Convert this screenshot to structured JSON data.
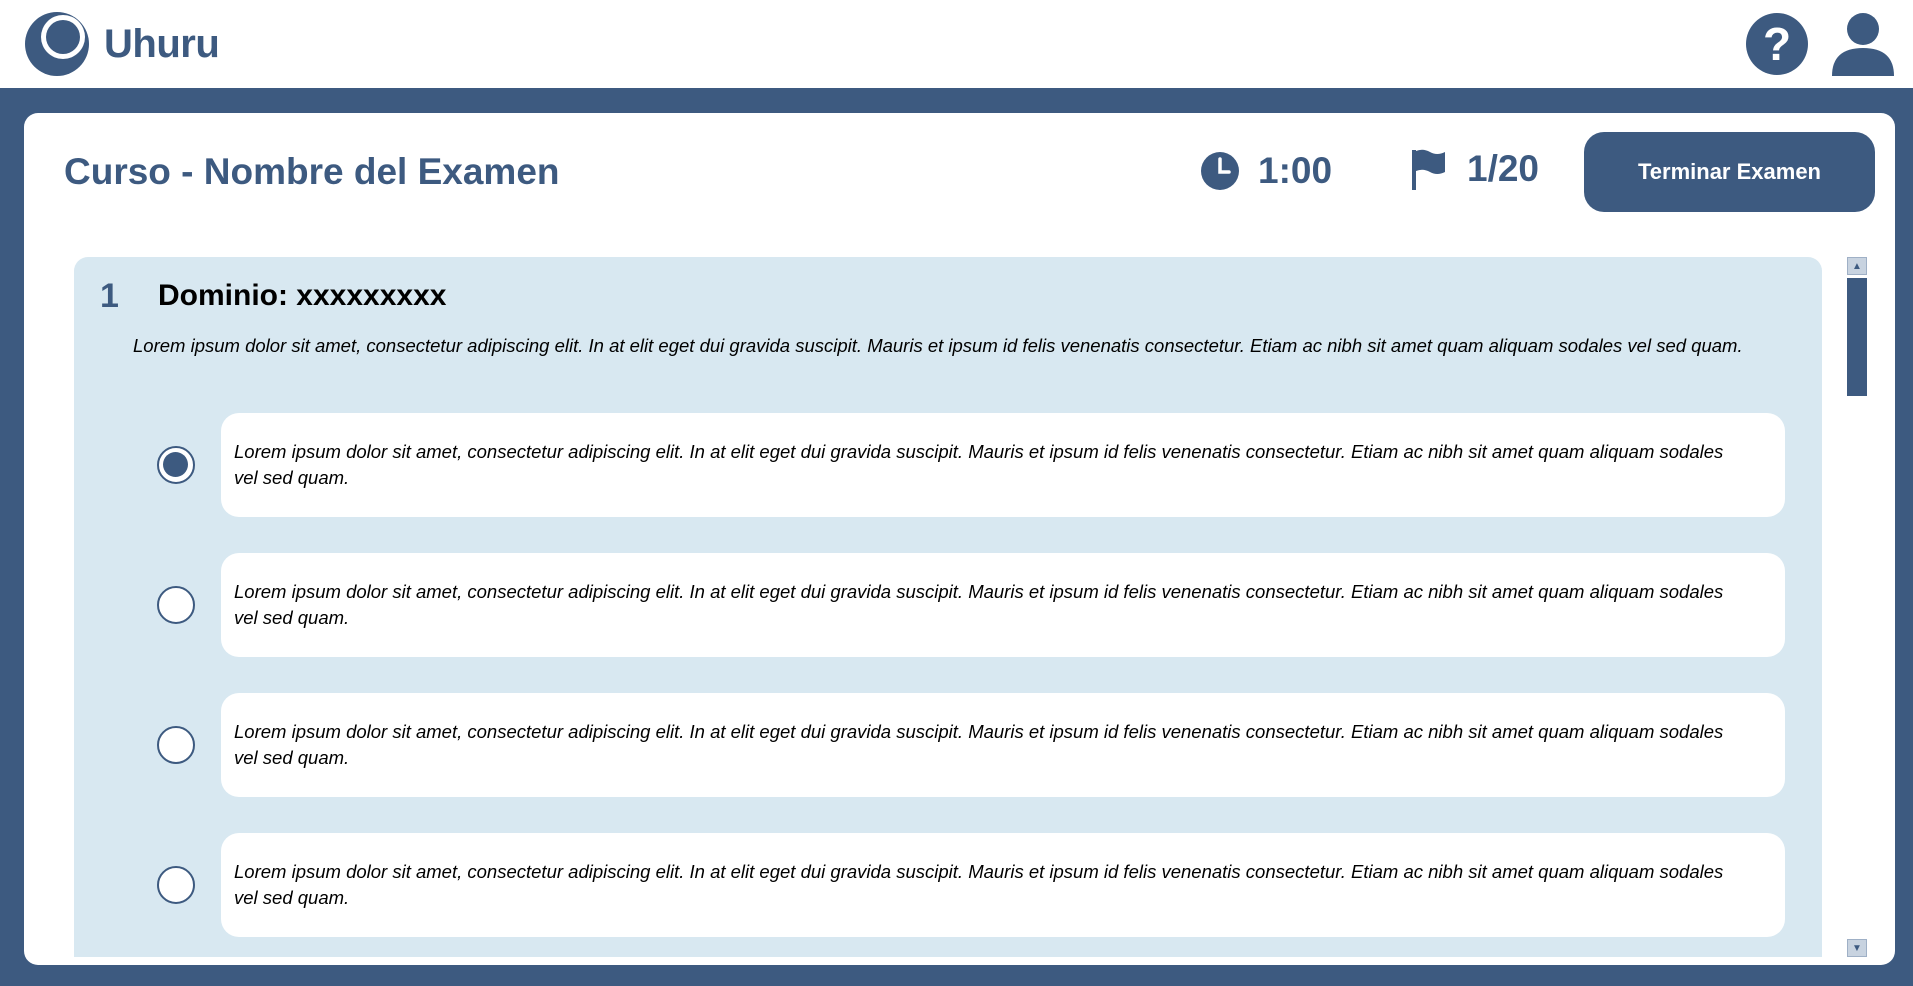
{
  "app": {
    "name": "Uhuru",
    "help_label": "?"
  },
  "exam": {
    "title": "Curso - Nombre del Examen",
    "timer": "1:00",
    "progress": "1/20",
    "finish_label": "Terminar Examen"
  },
  "question": {
    "number": "1",
    "domain": "Dominio: xxxxxxxxx",
    "text": "Lorem ipsum dolor sit amet, consectetur adipiscing elit. In at elit eget dui gravida suscipit. Mauris et ipsum id felis venenatis consectetur. Etiam ac nibh sit amet quam aliquam sodales vel sed quam.",
    "options": [
      {
        "text": "Lorem ipsum dolor sit amet, consectetur adipiscing elit. In at elit eget dui gravida suscipit. Mauris et ipsum id felis venenatis consectetur. Etiam ac nibh sit amet quam aliquam sodales vel sed quam.",
        "selected": true
      },
      {
        "text": "Lorem ipsum dolor sit amet, consectetur adipiscing elit. In at elit eget dui gravida suscipit. Mauris et ipsum id felis venenatis consectetur. Etiam ac nibh sit amet quam aliquam sodales vel sed quam.",
        "selected": false
      },
      {
        "text": "Lorem ipsum dolor sit amet, consectetur adipiscing elit. In at elit eget dui gravida suscipit. Mauris et ipsum id felis venenatis consectetur. Etiam ac nibh sit amet quam aliquam sodales vel sed quam.",
        "selected": false
      },
      {
        "text": "Lorem ipsum dolor sit amet, consectetur adipiscing elit. In at elit eget dui gravida suscipit. Mauris et ipsum id felis venenatis consectetur. Etiam ac nibh sit amet quam aliquam sodales vel sed quam.",
        "selected": false
      }
    ]
  },
  "icons": {
    "logo": "logo-icon",
    "help": "help-icon",
    "user": "user-icon",
    "timer": "clock-icon",
    "progress": "flag-icon"
  },
  "colors": {
    "brand": "#3d5a80",
    "panel": "#d8e8f1",
    "card": "#ffffff"
  }
}
